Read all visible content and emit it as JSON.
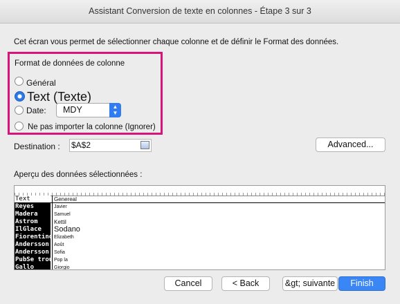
{
  "window": {
    "title": "Assistant Conversion de texte en colonnes - Étape 3 sur 3"
  },
  "description": "Cet écran vous permet de sélectionner chaque colonne et de définir le Format des données.",
  "column_format": {
    "label": "Format de données de colonne",
    "options": {
      "general": "Général",
      "text": "Text (Texte)",
      "date": "Date:",
      "skip": "Ne pas importer la colonne (Ignorer)"
    },
    "selected": "text",
    "date_format": "MDY"
  },
  "destination": {
    "label": "Destination :",
    "value": "$A$2"
  },
  "buttons": {
    "advanced": "Advanced...",
    "cancel": "Cancel",
    "back": "< Back",
    "next": "&gt; suivante",
    "finish": "Finish"
  },
  "preview": {
    "label": "Aperçu des données sélectionnées :",
    "header": [
      "Text",
      "Genereal"
    ],
    "rows": [
      [
        "Reyes",
        "Javier"
      ],
      [
        "Madera",
        "Samuel"
      ],
      [
        "Astrom",
        "Kettil"
      ],
      [
        "IlGlace",
        "Sodano"
      ],
      [
        "Fiorentino",
        "Elizabeth"
      ],
      [
        "Andersson",
        "Août"
      ],
      [
        "Andersson",
        "Sofia"
      ],
      [
        "PubSe trouve",
        "Pop la"
      ],
      [
        "Gallo",
        "Giorgio"
      ]
    ]
  }
}
